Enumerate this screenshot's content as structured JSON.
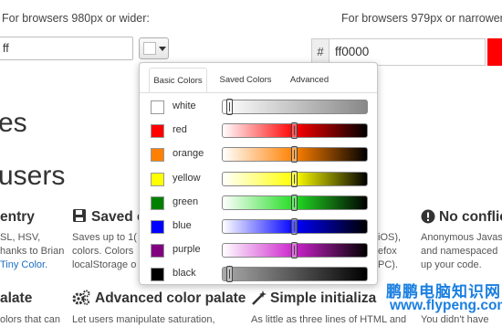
{
  "captions": {
    "left": "For browsers 980px or wider:",
    "right": "For browsers 979px or narrower:"
  },
  "left_input": {
    "value": "ff"
  },
  "right_input": {
    "prefix": "#",
    "value": "ff0000",
    "preview_color": "#ff0000"
  },
  "background": {
    "heading_es": "es",
    "heading_users": "users",
    "features": [
      {
        "title": "entry",
        "lines": [
          "SL, HSV,",
          "hanks to Brian",
          "Tiny Color."
        ],
        "link": "Tiny Color."
      },
      {
        "title": "Saved c",
        "lines": [
          "Saves up to 1(",
          "colors. Colors",
          "localStorage o"
        ]
      },
      {
        "title": "",
        "lines": [
          "iOS),",
          "efox",
          "PC)."
        ]
      },
      {
        "title": "No conflic",
        "lines": [
          "Anonymous Javas",
          "and namespaced",
          "up your code."
        ]
      }
    ],
    "bottom": [
      {
        "title": "alate",
        "text": "olors that can"
      },
      {
        "title": "Advanced color palate",
        "text": "Let users manipulate saturation,"
      },
      {
        "title": "Simple initializa",
        "text": "As little as three lines of HTML and"
      },
      {
        "title": "",
        "text": "You didn't have"
      }
    ]
  },
  "popover": {
    "tabs": [
      "Basic Colors",
      "Saved Colors",
      "Advanced"
    ],
    "active_tab": 0,
    "colors": [
      {
        "name": "white",
        "swatch": "#ffffff",
        "level": 0.05,
        "grad": [
          "#ffffff",
          "#888888"
        ]
      },
      {
        "name": "red",
        "swatch": "#ff0000",
        "level": 0.5,
        "grad": [
          "#ffffff",
          "#ff0000",
          "#000000"
        ]
      },
      {
        "name": "orange",
        "swatch": "#ff7f00",
        "level": 0.5,
        "grad": [
          "#ffffff",
          "#ff8000",
          "#000000"
        ]
      },
      {
        "name": "yellow",
        "swatch": "#ffff00",
        "level": 0.5,
        "grad": [
          "#ffffff",
          "#ffff00",
          "#000000"
        ]
      },
      {
        "name": "green",
        "swatch": "#008000",
        "level": 0.5,
        "grad": [
          "#ffffff",
          "#22dd22",
          "#000000"
        ]
      },
      {
        "name": "blue",
        "swatch": "#0000ff",
        "level": 0.5,
        "grad": [
          "#ffffff",
          "#0000ff",
          "#000000"
        ]
      },
      {
        "name": "purple",
        "swatch": "#800080",
        "level": 0.5,
        "grad": [
          "#ffffff",
          "#cc22cc",
          "#000000"
        ]
      },
      {
        "name": "black",
        "swatch": "#000000",
        "level": 0.05,
        "grad": [
          "#aaaaaa",
          "#000000"
        ]
      }
    ]
  },
  "watermark": {
    "line1": "鹏鹏电脑知识网",
    "line2": "www.flypeng.com"
  }
}
